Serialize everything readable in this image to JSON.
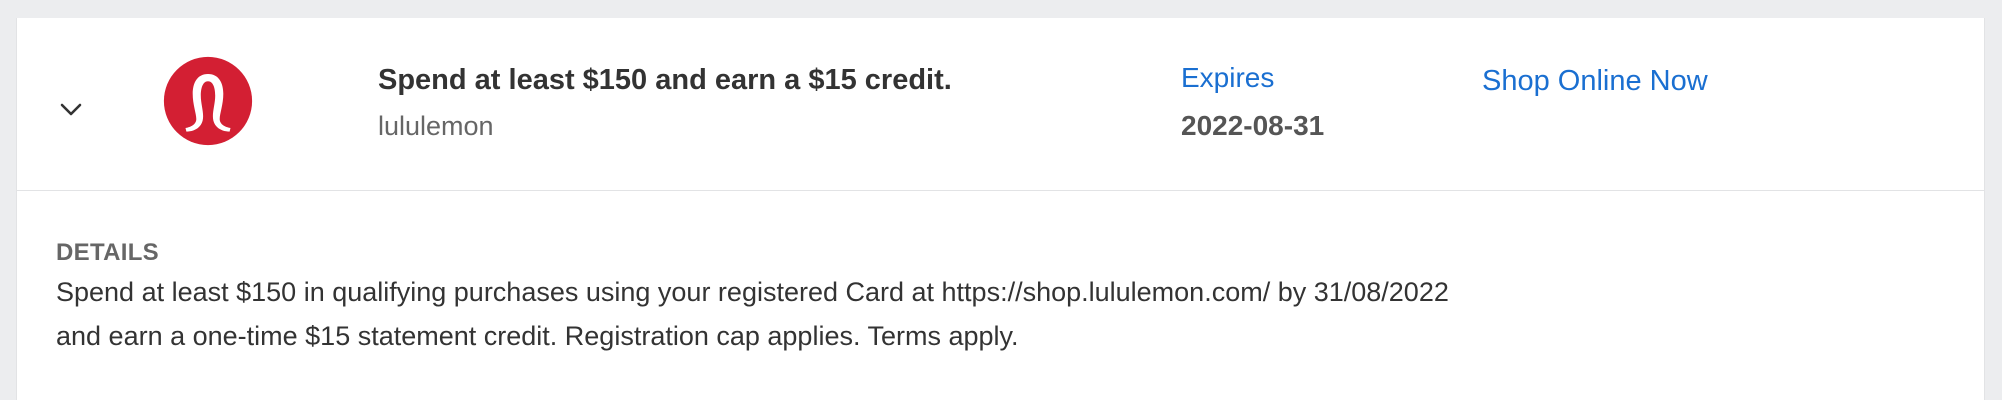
{
  "offer": {
    "title": "Spend at least $150 and earn a $15 credit.",
    "merchant": "lululemon",
    "expires_label": "Expires",
    "expires_date": "2022-08-31",
    "cta_label": "Shop Online Now",
    "logo_icon": "lululemon-logo-icon",
    "expand_icon": "chevron-down-icon"
  },
  "details": {
    "heading": "DETAILS",
    "text": "Spend at least $150 in qualifying purchases using your registered Card at https://shop.lululemon.com/ by 31/08/2022 and earn a one-time $15 statement credit. Registration cap applies. Terms apply."
  },
  "colors": {
    "link": "#1a6fd1",
    "logo_red": "#d31f33",
    "background": "#ecedef",
    "card": "#ffffff"
  }
}
